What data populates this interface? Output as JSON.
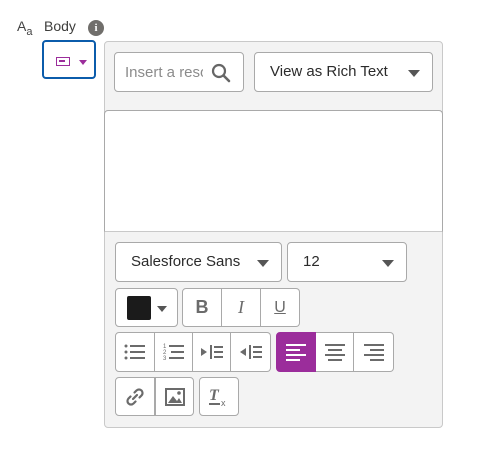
{
  "field": {
    "type_icon": "text-type-icon",
    "type_glyph_main": "A",
    "type_glyph_sub": "a",
    "label": "Body",
    "info_glyph": "i"
  },
  "trigger": {
    "icon": "rich-text-input-icon",
    "caret": "chevron-down-icon",
    "color": "#9b2d9b",
    "border_color": "#0b5cab"
  },
  "search": {
    "placeholder": "Insert a resource",
    "icon": "search-icon"
  },
  "view_as": {
    "label": "View as Rich Text"
  },
  "editor": {
    "content": ""
  },
  "toolbar": {
    "font_family": "Salesforce Sans",
    "font_size": "12",
    "text_color": "#1b1b1b",
    "bold_label": "B",
    "italic_label": "I",
    "underline_label": "U",
    "active_color": "#9b2d9b",
    "icons": {
      "bullet_list": "bulleted-list-icon",
      "numbered_list": "numbered-list-icon",
      "indent": "indent-icon",
      "outdent": "outdent-icon",
      "align_left": "align-left-icon",
      "align_center": "align-center-icon",
      "align_right": "align-right-icon",
      "link": "link-icon",
      "image": "image-icon",
      "clear_format": "clear-formatting-icon"
    },
    "active_alignment": "left"
  }
}
